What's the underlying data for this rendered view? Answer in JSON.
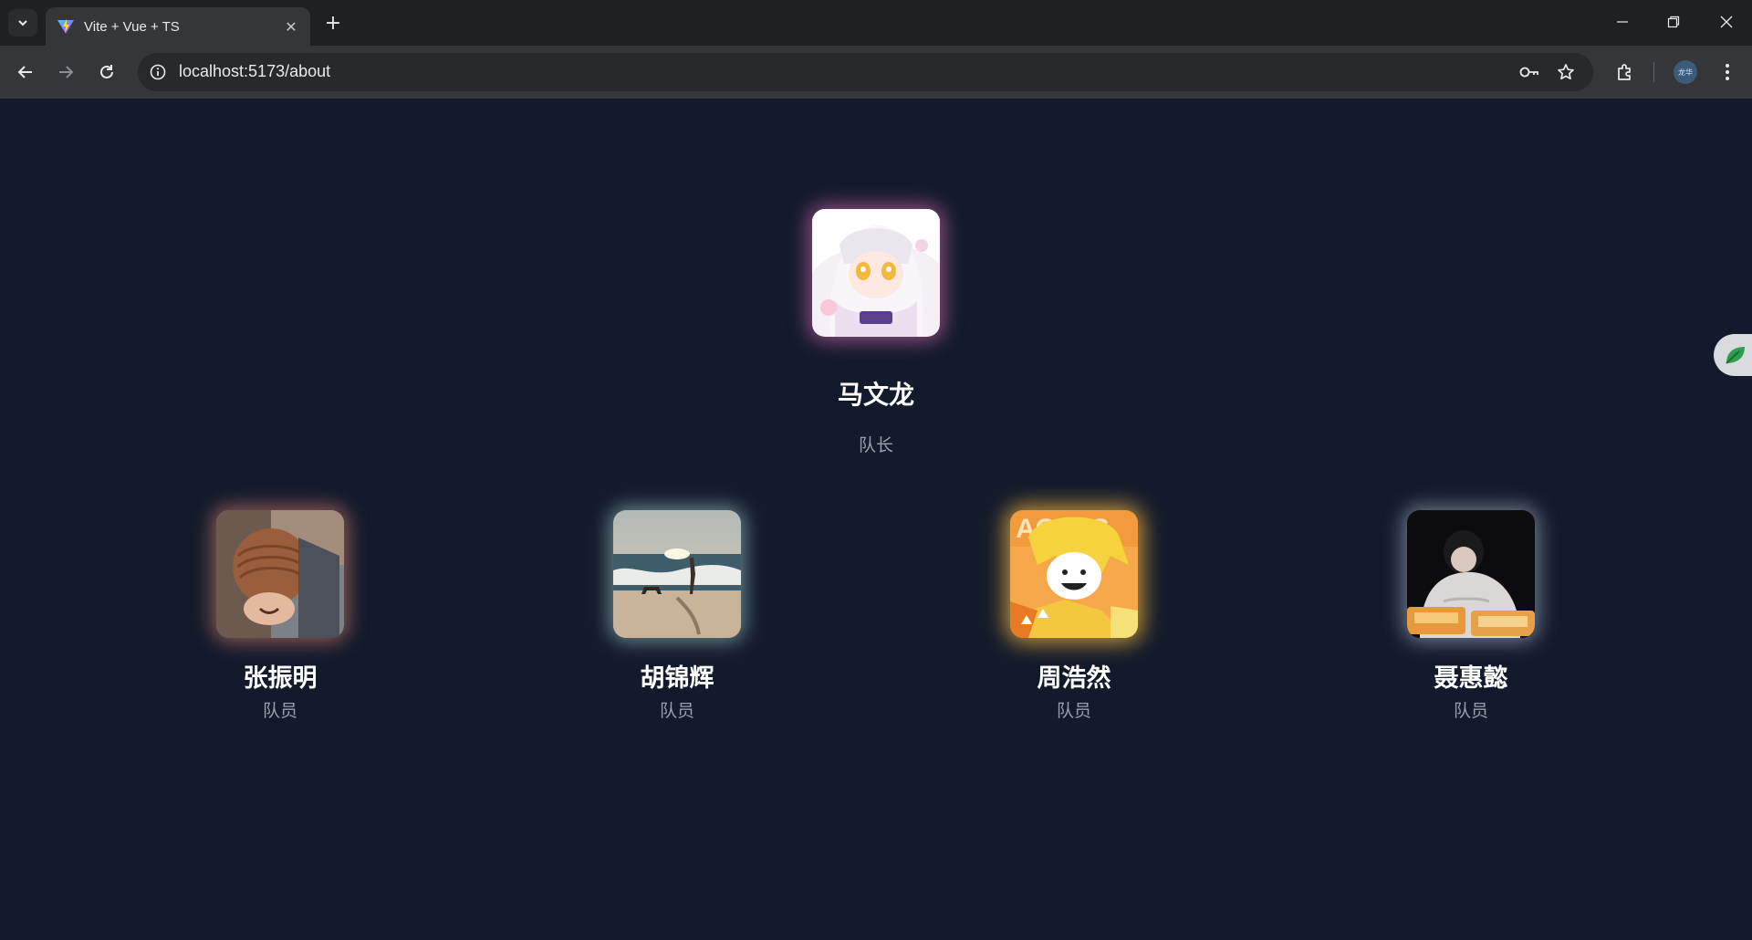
{
  "browser": {
    "tab_title": "Vite + Vue + TS",
    "url": "localhost:5173/about",
    "profile_label": "龙华"
  },
  "team": {
    "leader": {
      "name": "马文龙",
      "role": "队长"
    },
    "members": [
      {
        "name": "张振明",
        "role": "队员"
      },
      {
        "name": "胡锦辉",
        "role": "队员"
      },
      {
        "name": "周浩然",
        "role": "队员"
      },
      {
        "name": "聂惠懿",
        "role": "队员"
      }
    ]
  },
  "colors": {
    "page_background": "#131a2b",
    "leader_glow": "#c062a6",
    "member1_glow": "#c8786a",
    "member2_glow": "#8fb9b7",
    "member3_glow": "#f0b640",
    "member4_glow": "#9ba4bd"
  }
}
